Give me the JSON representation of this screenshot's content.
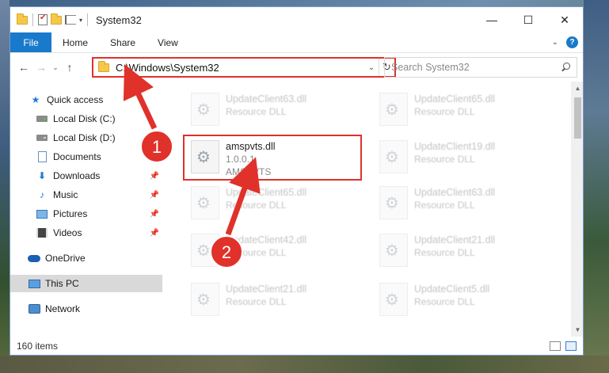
{
  "window": {
    "title": "System32",
    "controls": {
      "minimize": "—",
      "maximize": "☐",
      "close": "✕"
    }
  },
  "ribbon": {
    "file": "File",
    "tabs": [
      "Home",
      "Share",
      "View"
    ],
    "help": "?"
  },
  "nav": {
    "back": "←",
    "forward": "→",
    "recent": "⌄",
    "up": "↑",
    "address": "C:\\Windows\\System32",
    "refresh": "↻",
    "search_placeholder": "Search System32"
  },
  "sidebar": {
    "items": [
      {
        "label": "Quick access",
        "icon": "star-icon"
      },
      {
        "label": "Local Disk (C:)",
        "icon": "drive-icon"
      },
      {
        "label": "Local Disk (D:)",
        "icon": "drive-icon"
      },
      {
        "label": "Documents",
        "icon": "documents-icon"
      },
      {
        "label": "Downloads",
        "icon": "downloads-icon",
        "pinned": true
      },
      {
        "label": "Music",
        "icon": "music-icon",
        "pinned": true
      },
      {
        "label": "Pictures",
        "icon": "pictures-icon",
        "pinned": true
      },
      {
        "label": "Videos",
        "icon": "videos-icon",
        "pinned": true
      },
      {
        "label": "OneDrive",
        "icon": "onedrive-icon"
      },
      {
        "label": "This PC",
        "icon": "this-pc-icon",
        "selected": true
      },
      {
        "label": "Network",
        "icon": "network-icon"
      }
    ]
  },
  "files": [
    {
      "name": "UpdateClient63.dll",
      "sub": "Resource DLL"
    },
    {
      "name": "UpdateClient65.dll",
      "sub": "Resource DLL"
    },
    {
      "name": "amspvts.dll",
      "version": "1.0.0.1",
      "product": "AMSPVTS"
    },
    {
      "name": "UpdateClient19.dll",
      "sub": "Resource DLL"
    },
    {
      "name": "UpdateClient65.dll",
      "sub": "Resource DLL"
    },
    {
      "name": "UpdateClient63.dll",
      "sub": "Resource DLL"
    },
    {
      "name": "UpdateClient42.dll",
      "sub": "Resource DLL"
    },
    {
      "name": "UpdateClient21.dll",
      "sub": "Resource DLL"
    },
    {
      "name": "UpdateClient21.dll",
      "sub": "Resource DLL"
    },
    {
      "name": "UpdateClient5.dll",
      "sub": "Resource DLL"
    }
  ],
  "annotations": {
    "step1": "1",
    "step2": "2",
    "color": "#e0312a"
  },
  "status": {
    "items": "160 items"
  }
}
